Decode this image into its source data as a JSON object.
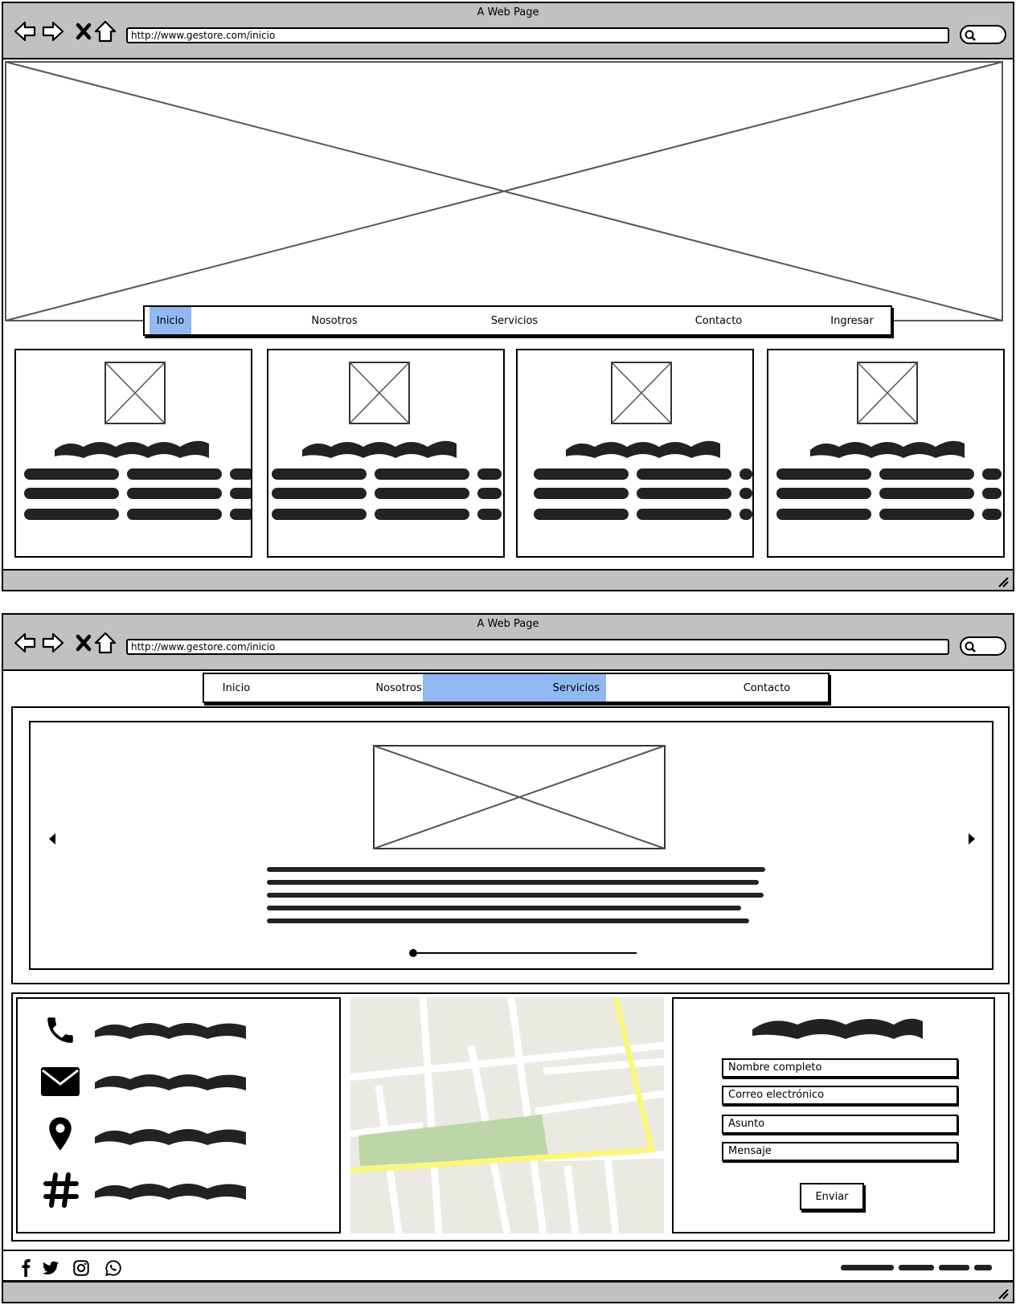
{
  "window1": {
    "title": "A Web Page",
    "url": "http://www.gestore.com/inicio",
    "nav": [
      {
        "label": "Inicio",
        "active": true
      },
      {
        "label": "Nosotros",
        "active": false
      },
      {
        "label": "Servicios",
        "active": false
      },
      {
        "label": "Contacto",
        "active": false
      },
      {
        "label": "Ingresar",
        "active": false
      }
    ],
    "cards": 4
  },
  "window2": {
    "title": "A Web Page",
    "url": "http://www.gestore.com/inicio",
    "nav": [
      {
        "label": "Inicio",
        "active": false
      },
      {
        "label": "Nosotros",
        "active": false
      },
      {
        "label": "Servicios",
        "active": true
      },
      {
        "label": "Contacto",
        "active": false
      }
    ],
    "carousel": {
      "prev_icon": "arrow-left-icon",
      "next_icon": "arrow-right-icon",
      "progress": 0.0
    },
    "contact_icons": [
      "phone-icon",
      "envelope-icon",
      "map-pin-icon",
      "hashtag-icon"
    ],
    "form": {
      "fields": [
        "Nombre completo",
        "Correo electrónico",
        "Asunto",
        "Mensaje"
      ],
      "submit": "Enviar"
    },
    "social_icons": [
      "facebook-icon",
      "twitter-icon",
      "instagram-icon",
      "whatsapp-icon"
    ]
  },
  "colors": {
    "chrome": "#c1c1c1",
    "active_tab": "#91b8f1",
    "map_bg": "#eae9e2",
    "map_park": "#bcd6a8",
    "map_road": "#fbf77c"
  }
}
